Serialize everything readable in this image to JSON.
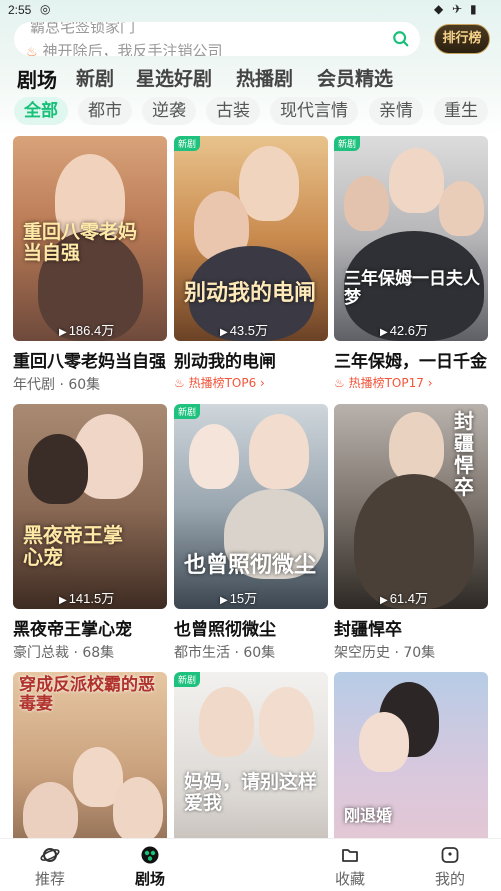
{
  "status_bar": {
    "time": "2:55"
  },
  "search": {
    "line1": "霸总宅签锁家门",
    "line2": "神开除后，我反手注销公司",
    "rank_label": "排行榜"
  },
  "main_tabs": [
    "剧场",
    "新剧",
    "星选好剧",
    "热播剧",
    "会员精选"
  ],
  "categories": [
    "全部",
    "都市",
    "逆袭",
    "古装",
    "现代言情",
    "亲情",
    "重生"
  ],
  "cards": [
    {
      "title": "重回八零老妈当自强",
      "poster_text": "重回八零老妈当自强",
      "views": "186.4万",
      "meta": "年代剧 · 60集",
      "new": false,
      "hot": false
    },
    {
      "title": "别动我的电闸",
      "poster_text": "别动我的电闸",
      "views": "43.5万",
      "meta": "热播榜TOP6",
      "new": true,
      "hot": true
    },
    {
      "title": "三年保姆，一日千金",
      "poster_text": "三年保姆一日夫人梦",
      "views": "42.6万",
      "meta": "热播榜TOP17",
      "new": true,
      "hot": true
    },
    {
      "title": "黑夜帝王掌心宠",
      "poster_text": "黑夜帝王掌心宠",
      "views": "141.5万",
      "meta": "豪门总裁 · 68集",
      "new": false,
      "hot": false
    },
    {
      "title": "也曾照彻微尘",
      "poster_text": "也曾照彻微尘",
      "views": "15万",
      "meta": "都市生活 · 60集",
      "new": true,
      "hot": false
    },
    {
      "title": "封疆悍卒",
      "poster_text": "封疆悍卒",
      "views": "61.4万",
      "meta": "架空历史 · 70集",
      "new": false,
      "hot": false
    },
    {
      "title": "穿成反派校霸的恶毒妻",
      "poster_text": "穿成反派校霸的恶毒妻",
      "views": "",
      "meta": "",
      "new": false,
      "hot": false
    },
    {
      "title": "妈妈请别这样爱我",
      "poster_text": "妈妈，请别这样爱我",
      "views": "",
      "meta": "",
      "new": true,
      "hot": false
    },
    {
      "title": "刚退婚",
      "poster_text": "刚退婚",
      "views": "",
      "meta": "",
      "new": false,
      "hot": false
    }
  ],
  "bottom_nav": [
    {
      "label": "推荐",
      "icon": "planet-icon"
    },
    {
      "label": "剧场",
      "icon": "theater-icon"
    },
    {
      "label": "收藏",
      "icon": "folder-icon"
    },
    {
      "label": "我的",
      "icon": "profile-icon"
    }
  ],
  "colors": {
    "accent": "#19c07a",
    "hot": "#f2553a",
    "new_badge": "#1ec27e"
  }
}
